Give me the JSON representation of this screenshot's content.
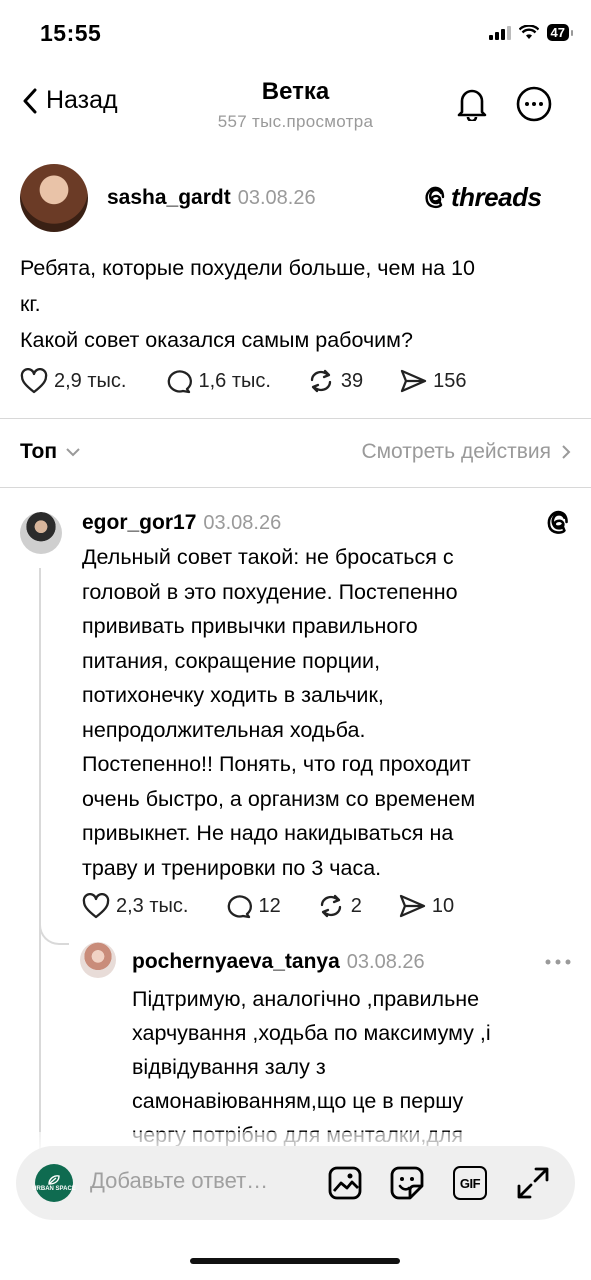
{
  "status_bar": {
    "time": "15:55",
    "battery": "47"
  },
  "nav": {
    "back_label": "Назад",
    "title": "Ветка",
    "subtitle": "557 тыс.просмотра"
  },
  "post": {
    "username": "sasha_gardt",
    "date": "03.08.26",
    "brand": "threads",
    "text_lines": [
      "Ребята, которые похудели больше, чем на 10",
      "кг.",
      "Какой совет оказался самым рабочим?"
    ],
    "likes": "2,9 тыс.",
    "comments": "1,6 тыс.",
    "reposts": "39",
    "shares": "156"
  },
  "sort": {
    "label": "Топ",
    "see_actions": "Смотреть действия"
  },
  "comment": {
    "username": "egor_gor17",
    "date": "03.08.26",
    "text_lines": [
      "Дельный совет такой: не бросаться с",
      "головой в это похудение. Постепенно",
      "прививать привычки правильного",
      "питания, сокращение порции,",
      "потихонечку ходить в зальчик,",
      "непродолжительная ходьба.",
      "Постепенно!! Понять, что год проходит",
      "очень быстро, а организм со временем",
      "привыкнет. Не надо накидываться на",
      "траву и тренировки по 3 часа."
    ],
    "likes": "2,3 тыс.",
    "comments": "12",
    "reposts": "2",
    "shares": "10"
  },
  "reply": {
    "username": "pochernyaeva_tanya",
    "date": "03.08.26",
    "text_lines": [
      "Підтримую, аналогічно ,правильне",
      "харчування ,ходьба по максимуму ,і",
      "відвідування залу з",
      "самонавіюванням,що це в першу",
      "чергу потрібно для менталки,для"
    ]
  },
  "composer": {
    "placeholder": "Добавьте ответ…",
    "avatar_text": "URBAN SPACE",
    "gif_label": "GIF"
  },
  "colors": {
    "muted": "#9a9a9a",
    "divider": "#d8d8d8",
    "composer_bg": "#efefef",
    "avatar_green": "#0f6b50"
  }
}
